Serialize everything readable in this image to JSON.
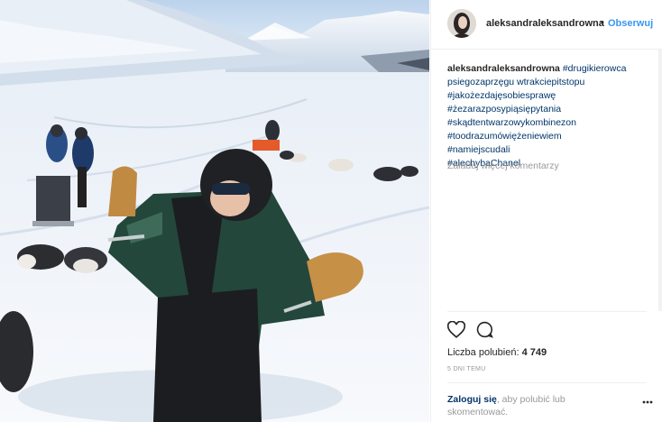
{
  "post": {
    "username": "aleksandraleksandrowna",
    "separator": "•",
    "follow_label": "Obserwuj",
    "caption": {
      "username": "aleksandraleksandrowna",
      "first_tag": "#drugikierowca",
      "tags": [
        "psiegozaprzęgu wtrakciepitstopu",
        "#jakożezdajęsobiesprawę",
        "#żezarazposypiąsiępytania",
        "#skądtentwarzowykombinezon",
        "#toodrazumówiężeniewiem",
        "#namiejscudali",
        "#alechybaChanel"
      ],
      "tags_line2": "psiegozaprzęgu wtrakciepitstopu"
    },
    "load_more_label": "Załaduj więcej komentarzy",
    "likes_label": "Liczba polubień:",
    "likes_count": "4 749",
    "time_label": "5 DNI TEMU",
    "login_link": "Zaloguj się",
    "login_text": ", aby polubić lub skomentować.",
    "icons": {
      "like": "heart-icon",
      "comment": "comment-icon",
      "more": "more-options-icon"
    }
  }
}
